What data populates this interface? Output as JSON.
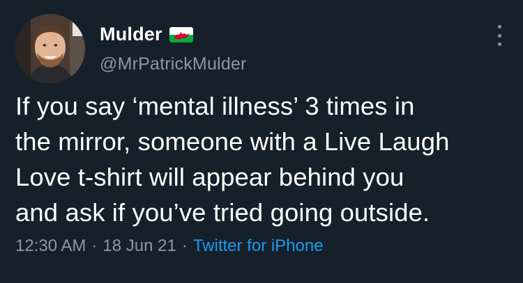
{
  "author": {
    "display_name": "Mulder",
    "handle": "@MrPatrickMulder",
    "flag_icon": "wales-flag-icon",
    "avatar_icon": "profile-avatar"
  },
  "tweet": {
    "lines": [
      "If you say ‘mental illness’ 3 times in",
      "the mirror, someone with a Live Laugh",
      "Love t-shirt will appear behind you",
      "and ask if you’ve tried going outside."
    ]
  },
  "meta": {
    "time": "12:30 AM",
    "separator": "·",
    "date": "18 Jun 21",
    "source": "Twitter for iPhone"
  },
  "colors": {
    "background": "#15202b",
    "text": "#ffffff",
    "secondary_text": "#8b98a5",
    "link": "#1d9bf0"
  }
}
